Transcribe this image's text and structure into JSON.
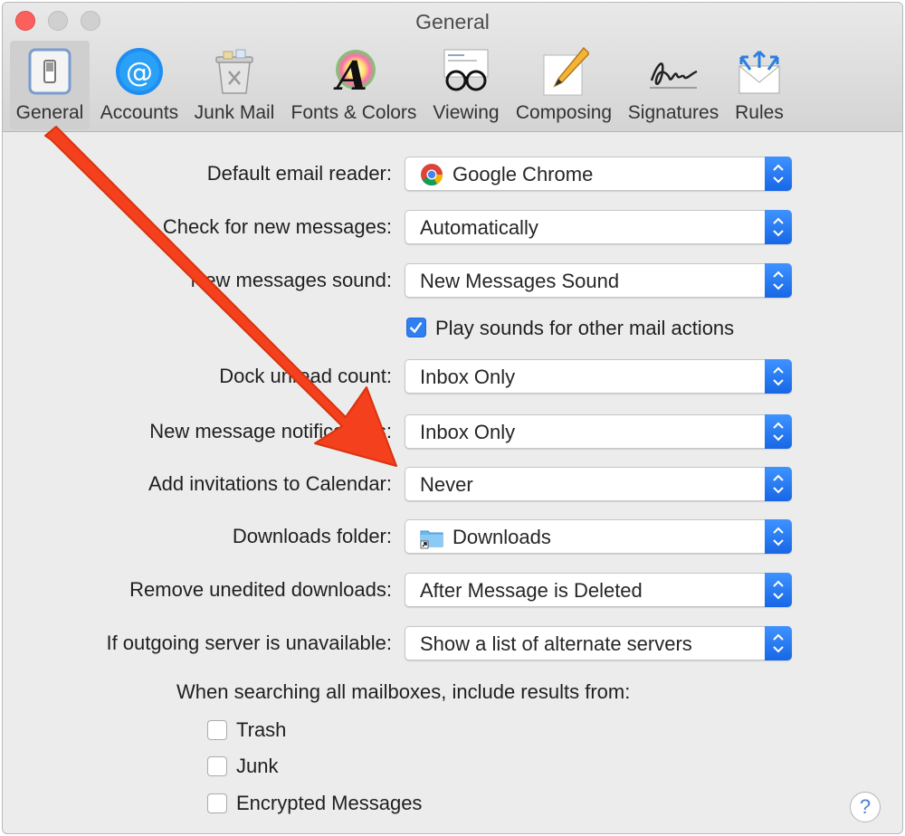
{
  "window": {
    "title": "General"
  },
  "toolbar": {
    "items": [
      {
        "label": "General",
        "icon": "general-switch-icon",
        "selected": true
      },
      {
        "label": "Accounts",
        "icon": "at-sign-icon"
      },
      {
        "label": "Junk Mail",
        "icon": "trash-bin-icon"
      },
      {
        "label": "Fonts & Colors",
        "icon": "color-letter-a-icon"
      },
      {
        "label": "Viewing",
        "icon": "glasses-icon"
      },
      {
        "label": "Composing",
        "icon": "pencil-paper-icon"
      },
      {
        "label": "Signatures",
        "icon": "signature-icon"
      },
      {
        "label": "Rules",
        "icon": "envelope-arrows-icon"
      }
    ]
  },
  "settings": {
    "default_email_reader": {
      "label": "Default email reader:",
      "value": "Google Chrome",
      "icon": "chrome-icon"
    },
    "check_new_messages": {
      "label": "Check for new messages:",
      "value": "Automatically"
    },
    "new_messages_sound": {
      "label": "New messages sound:",
      "value": "New Messages Sound"
    },
    "play_sounds": {
      "label": "Play sounds for other mail actions",
      "checked": true
    },
    "dock_unread_count": {
      "label": "Dock unread count:",
      "value": "Inbox Only"
    },
    "new_message_notifications": {
      "label": "New message notifications:",
      "value": "Inbox Only"
    },
    "add_invitations": {
      "label": "Add invitations to Calendar:",
      "value": "Never"
    },
    "downloads_folder": {
      "label": "Downloads folder:",
      "value": "Downloads",
      "icon": "folder-icon"
    },
    "remove_unedited_downloads": {
      "label": "Remove unedited downloads:",
      "value": "After Message is Deleted"
    },
    "outgoing_server": {
      "label": "If outgoing server is unavailable:",
      "value": "Show a list of alternate servers"
    }
  },
  "search": {
    "title": "When searching all mailboxes, include results from:",
    "options": [
      {
        "label": "Trash",
        "checked": false
      },
      {
        "label": "Junk",
        "checked": false
      },
      {
        "label": "Encrypted Messages",
        "checked": false
      }
    ]
  },
  "help": {
    "label": "?"
  },
  "colors": {
    "accent": "#2f7ff0",
    "annotation_arrow": "#f4401c",
    "close_button": "#fc605c"
  }
}
